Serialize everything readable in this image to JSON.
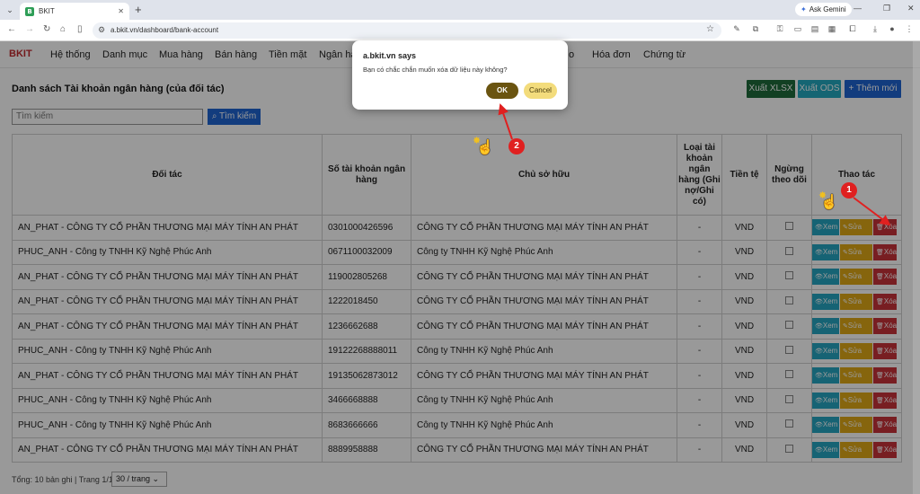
{
  "browser": {
    "tab_title": "BKIT",
    "favicon_letter": "B",
    "url": "a.bkit.vn/dashboard/bank-account",
    "gemini_label": "Ask Gemini"
  },
  "app": {
    "brand": "BKIT",
    "menu": [
      "Hệ thống",
      "Danh mục",
      "Mua hàng",
      "Bán hàng",
      "Tiền mặt",
      "Ngân hà",
      "o",
      "Hóa đơn",
      "Chứng từ"
    ],
    "page_title": "Danh sách Tài khoản ngân hàng (của đối tác)",
    "btn_xlsx": "Xuất XLSX",
    "btn_ods": "Xuất ODS",
    "btn_new": "+ Thêm mới",
    "search_placeholder": "Tìm kiếm",
    "search_button": "Tìm kiếm",
    "columns": {
      "partner": "Đối tác",
      "account": "Số tài khoản ngân hàng",
      "owner": "Chủ sở hữu",
      "type": "Loại tài khoản ngân hàng (Ghi nợ/Ghi có)",
      "currency": "Tiền tệ",
      "stopped": "Ngừng theo dõi",
      "actions": "Thao tác"
    },
    "rows": [
      {
        "partner": "AN_PHAT - CÔNG TY CỔ PHẦN THƯƠNG MẠI MÁY TÍNH AN PHÁT",
        "account": "0301000426596",
        "owner": "CÔNG TY CỔ PHẦN THƯƠNG MẠI MÁY TÍNH AN PHÁT",
        "type": "-",
        "currency": "VND"
      },
      {
        "partner": "PHUC_ANH - Công ty TNHH Kỹ Nghệ Phúc Anh",
        "account": "0671100032009",
        "owner": "Công ty TNHH Kỹ Nghệ Phúc Anh",
        "type": "-",
        "currency": "VND"
      },
      {
        "partner": "AN_PHAT - CÔNG TY CỔ PHẦN THƯƠNG MẠI MÁY TÍNH AN PHÁT",
        "account": "119002805268",
        "owner": "CÔNG TY CỔ PHẦN THƯƠNG MẠI MÁY TÍNH AN PHÁT",
        "type": "-",
        "currency": "VND"
      },
      {
        "partner": "AN_PHAT - CÔNG TY CỔ PHẦN THƯƠNG MẠI MÁY TÍNH AN PHÁT",
        "account": "1222018450",
        "owner": "CÔNG TY CỔ PHẦN THƯƠNG MẠI MÁY TÍNH AN PHÁT",
        "type": "-",
        "currency": "VND"
      },
      {
        "partner": "AN_PHAT - CÔNG TY CỔ PHẦN THƯƠNG MẠI MÁY TÍNH AN PHÁT",
        "account": "1236662688",
        "owner": "CÔNG TY CỔ PHẦN THƯƠNG MẠI MÁY TÍNH AN PHÁT",
        "type": "-",
        "currency": "VND"
      },
      {
        "partner": "PHUC_ANH - Công ty TNHH Kỹ Nghệ Phúc Anh",
        "account": "19122268888011",
        "owner": "Công ty TNHH Kỹ Nghệ Phúc Anh",
        "type": "-",
        "currency": "VND"
      },
      {
        "partner": "AN_PHAT - CÔNG TY CỔ PHẦN THƯƠNG MẠI MÁY TÍNH AN PHÁT",
        "account": "19135062873012",
        "owner": "CÔNG TY CỔ PHẦN THƯƠNG MẠI MÁY TÍNH AN PHÁT",
        "type": "-",
        "currency": "VND"
      },
      {
        "partner": "PHUC_ANH - Công ty TNHH Kỹ Nghệ Phúc Anh",
        "account": "3466668888",
        "owner": "Công ty TNHH Kỹ Nghệ Phúc Anh",
        "type": "-",
        "currency": "VND"
      },
      {
        "partner": "PHUC_ANH - Công ty TNHH Kỹ Nghệ Phúc Anh",
        "account": "8683666666",
        "owner": "Công ty TNHH Kỹ Nghệ Phúc Anh",
        "type": "-",
        "currency": "VND"
      },
      {
        "partner": "AN_PHAT - CÔNG TY CỔ PHẦN THƯƠNG MẠI MÁY TÍNH AN PHÁT",
        "account": "8889958888",
        "owner": "CÔNG TY CỔ PHẦN THƯƠNG MẠI MÁY TÍNH AN PHÁT",
        "type": "-",
        "currency": "VND"
      }
    ],
    "row_actions": {
      "view": "Xem",
      "edit": "Sửa",
      "delete": "Xóa"
    },
    "footer_info": "Tổng: 10 bản ghi | Trang 1/1",
    "page_size": "30 / trang"
  },
  "dialog": {
    "title": "a.bkit.vn says",
    "message": "Bạn có chắc chắn muốn xóa dữ liệu này không?",
    "ok": "OK",
    "cancel": "Cancel"
  },
  "annotations": {
    "step1": "1",
    "step2": "2",
    "color": "#e02020"
  }
}
